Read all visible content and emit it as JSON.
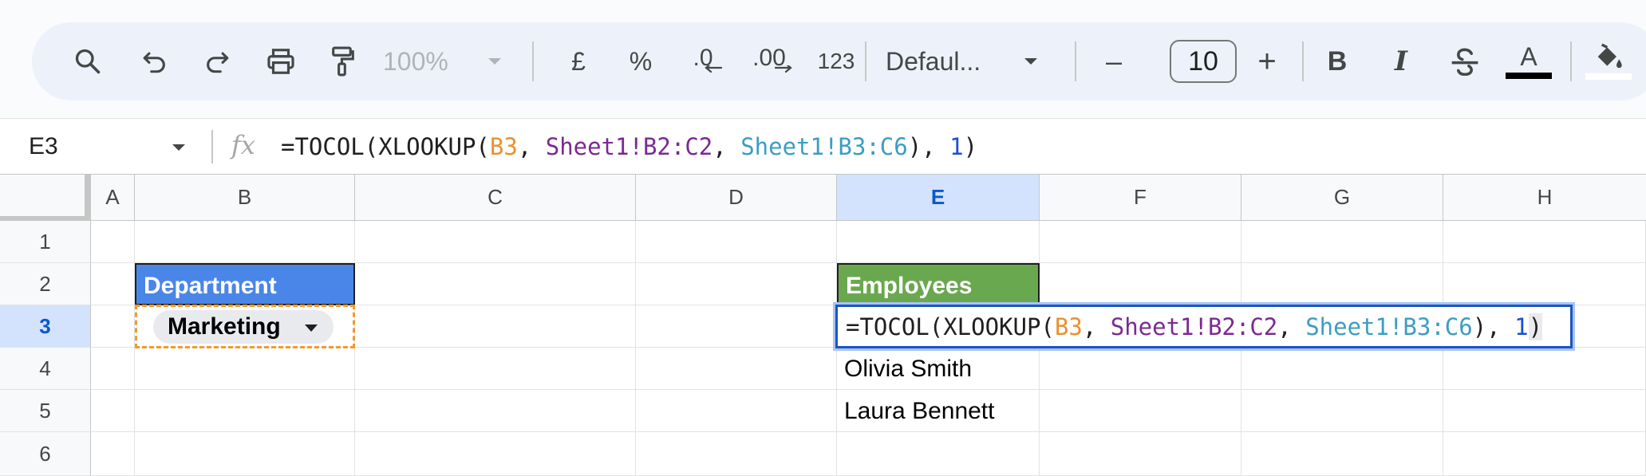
{
  "toolbar": {
    "zoom": "100%",
    "currency": "£",
    "percent": "%",
    "decrease_decimal": ".0",
    "increase_decimal": ".00",
    "number_format": "123",
    "font_name": "Defaul...",
    "font_size": "10",
    "minus": "–",
    "plus": "+",
    "bold": "B",
    "italic": "I",
    "text_color": "A",
    "icons": [
      "search-icon",
      "undo-icon",
      "redo-icon",
      "print-icon",
      "paint-format-icon",
      "zoom-dropdown-icon",
      "font-dropdown-icon",
      "strikethrough-icon",
      "text-color-icon",
      "fill-color-icon",
      "borders-icon"
    ]
  },
  "formula_bar": {
    "cell_ref": "E3",
    "fx": "fx",
    "formula_parts": [
      {
        "text": "=TOCOL(XLOOKUP(",
        "color": "default"
      },
      {
        "text": "B3",
        "color": "orange"
      },
      {
        "text": ", ",
        "color": "default"
      },
      {
        "text": "Sheet1!B2:C2",
        "color": "purple"
      },
      {
        "text": ", ",
        "color": "default"
      },
      {
        "text": "Sheet1!B3:C6",
        "color": "teal"
      },
      {
        "text": "), ",
        "color": "default"
      },
      {
        "text": "1",
        "color": "blue"
      },
      {
        "text": ")",
        "color": "default"
      }
    ]
  },
  "grid": {
    "columns": [
      "A",
      "B",
      "C",
      "D",
      "E",
      "F",
      "G",
      "H"
    ],
    "rows": [
      "1",
      "2",
      "3",
      "4",
      "5",
      "6"
    ],
    "active_column": "E",
    "active_row": "3",
    "cells": {
      "B2": "Department",
      "B3": "Marketing",
      "E2": "Employees",
      "E4": "Olivia Smith",
      "E5": "Laura Bennett"
    },
    "colors": {
      "department_header": "#4a86e8",
      "employees_header": "#6aa84f",
      "selection": "#1a55c4"
    }
  }
}
